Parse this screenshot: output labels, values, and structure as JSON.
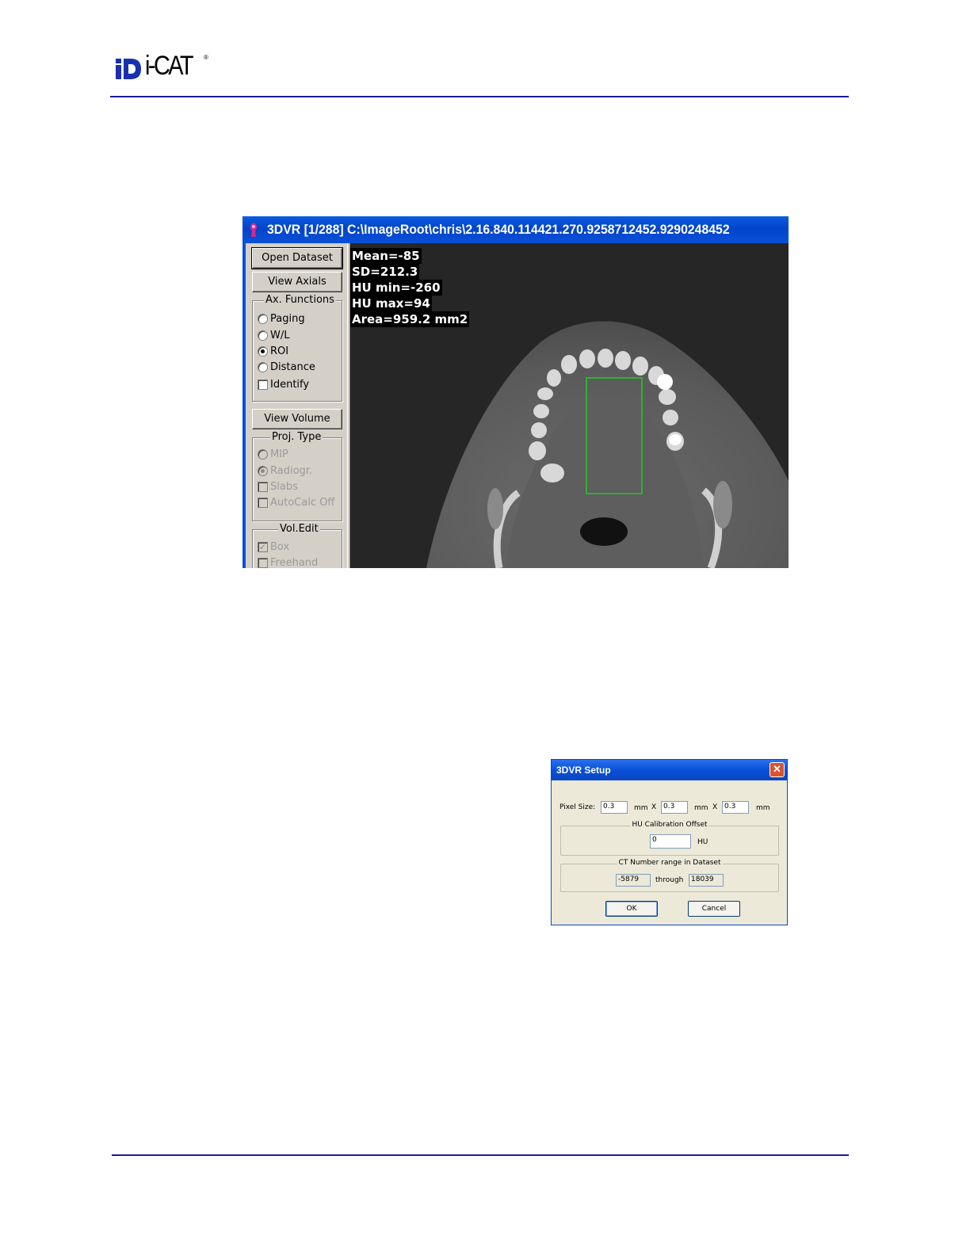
{
  "header": {
    "logo_text": "i-CAT",
    "logo_mark": "iD",
    "registered": "®"
  },
  "main_window": {
    "title": "3DVR [1/288] C:\\ImageRoot\\chris\\2.16.840.114421.270.9258712452.9290248452",
    "buttons": {
      "open_dataset": "Open Dataset",
      "view_axials": "View Axials",
      "view_volume": "View Volume"
    },
    "ax_functions": {
      "legend": "Ax. Functions",
      "paging": "Paging",
      "wl": "W/L",
      "roi": "ROI",
      "distance": "Distance",
      "identify": "Identify",
      "selected": "ROI"
    },
    "proj_type": {
      "legend": "Proj. Type",
      "mip": "MIP",
      "radiogr": "Radiogr.",
      "slabs": "Slabs",
      "autocalc_off": "AutoCalc Off",
      "selected": "Radiogr."
    },
    "vol_edit": {
      "legend": "Vol.Edit",
      "box": "Box",
      "box_checked": true,
      "freehand": "Freehand"
    },
    "roi_stats": {
      "mean": "Mean=-85",
      "sd": "SD=212.3",
      "hu_min": "HU min=-260",
      "hu_max": "HU max=94",
      "area": "Area=959.2 mm2"
    },
    "roi_color": "#22cc22"
  },
  "setup_dialog": {
    "title": "3DVR Setup",
    "pixel_size_label": "Pixel Size:",
    "pixel_x": "0.3",
    "pixel_y": "0.3",
    "pixel_z": "0.3",
    "unit_mm": "mm",
    "times": "X",
    "hu_group": "HU Calibration Offset",
    "hu_offset": "0",
    "hu_unit": "HU",
    "ct_group": "CT Number range in Dataset",
    "ct_from": "-5879",
    "ct_through": "through",
    "ct_to": "18039",
    "ok": "OK",
    "cancel": "Cancel"
  }
}
